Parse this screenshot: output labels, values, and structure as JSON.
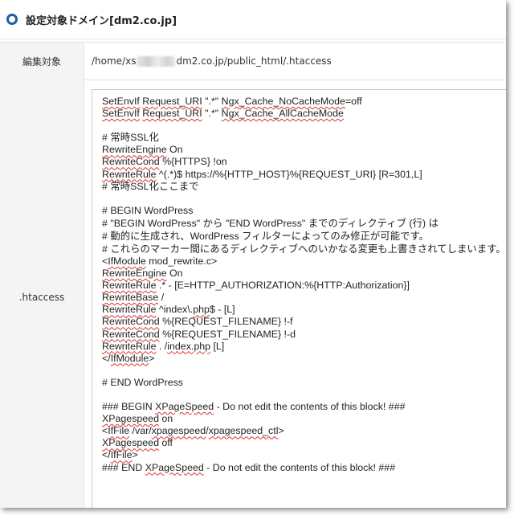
{
  "header": {
    "title": "設定対象ドメイン[dm2.co.jp]"
  },
  "target": {
    "label": "編集対象",
    "path_prefix": "/home/xs",
    "path_suffix": "dm2.co.jp/public_html/.htaccess"
  },
  "htaccess": {
    "label": ".htaccess",
    "lines": [
      [
        [
          "SetEnvIf",
          true
        ],
        [
          " ",
          false
        ],
        [
          "Request_URI",
          true
        ],
        [
          " \".*\" ",
          false
        ],
        [
          "Ngx_Cache_NoCacheMode",
          true
        ],
        [
          "=off",
          false
        ]
      ],
      [
        [
          "SetEnvIf",
          true
        ],
        [
          " ",
          false
        ],
        [
          "Request_URI",
          true
        ],
        [
          " \".*\" ",
          false
        ],
        [
          "Ngx_Cache_AllCacheMode",
          true
        ]
      ],
      [],
      [
        [
          "# 常時SSL化",
          false
        ]
      ],
      [
        [
          "RewriteEngine",
          true
        ],
        [
          " On",
          false
        ]
      ],
      [
        [
          "RewriteCond",
          true
        ],
        [
          " %{HTTPS} !on",
          false
        ]
      ],
      [
        [
          "RewriteRule",
          true
        ],
        [
          " ^(.*)$ https://%{HTTP_HOST}%{REQUEST_URI} [R=301,L]",
          false
        ]
      ],
      [
        [
          "# 常時SSL化ここまで",
          false
        ]
      ],
      [],
      [
        [
          "# BEGIN WordPress",
          false
        ]
      ],
      [
        [
          "# \"BEGIN WordPress\" から \"END WordPress\" までのディレクティブ (行) は",
          false
        ]
      ],
      [
        [
          "# 動的に生成され、WordPress フィルターによってのみ修正が可能です。",
          false
        ]
      ],
      [
        [
          "# これらのマーカー間にあるディレクティブへのいかなる変更も上書きされてしまいます。",
          false
        ]
      ],
      [
        [
          "<",
          false
        ],
        [
          "IfModule",
          true
        ],
        [
          " mod_rewrite.c>",
          false
        ]
      ],
      [
        [
          "RewriteEngine",
          true
        ],
        [
          " On",
          false
        ]
      ],
      [
        [
          "RewriteRule",
          true
        ],
        [
          " .* - [E=HTTP_AUTHORIZATION:%{HTTP:Authorization}]",
          false
        ]
      ],
      [
        [
          "RewriteBase",
          true
        ],
        [
          " /",
          false
        ]
      ],
      [
        [
          "RewriteRule",
          true
        ],
        [
          " ^index\\.",
          false
        ],
        [
          "php",
          true
        ],
        [
          "$ - [L]",
          false
        ]
      ],
      [
        [
          "RewriteCond",
          true
        ],
        [
          " %{REQUEST_FILENAME} !-f",
          false
        ]
      ],
      [
        [
          "RewriteCond",
          true
        ],
        [
          " %{REQUEST_FILENAME} !-d",
          false
        ]
      ],
      [
        [
          "RewriteRule",
          true
        ],
        [
          " . /",
          false
        ],
        [
          "index.php",
          true
        ],
        [
          " [L]",
          false
        ]
      ],
      [
        [
          "</",
          false
        ],
        [
          "IfModule",
          true
        ],
        [
          ">",
          false
        ]
      ],
      [],
      [
        [
          "# END WordPress",
          false
        ]
      ],
      [],
      [
        [
          "### BEGIN ",
          false
        ],
        [
          "XPageSpeed",
          true
        ],
        [
          " - Do not edit the contents of this block! ###",
          false
        ]
      ],
      [
        [
          "XPagespeed",
          true
        ],
        [
          " on",
          false
        ]
      ],
      [
        [
          "<",
          false
        ],
        [
          "IfFile",
          true
        ],
        [
          " /var/",
          false
        ],
        [
          "xpagespeed",
          true
        ],
        [
          "/",
          false
        ],
        [
          "xpagespeed_ctl",
          true
        ],
        [
          ">",
          false
        ]
      ],
      [
        [
          "XPagespeed",
          true
        ],
        [
          " off",
          false
        ]
      ],
      [
        [
          "</",
          false
        ],
        [
          "IfFile",
          true
        ],
        [
          ">",
          false
        ]
      ],
      [
        [
          "### END ",
          false
        ],
        [
          "XPageSpeed",
          true
        ],
        [
          " - Do not edit the contents of this block! ###",
          false
        ]
      ]
    ]
  }
}
